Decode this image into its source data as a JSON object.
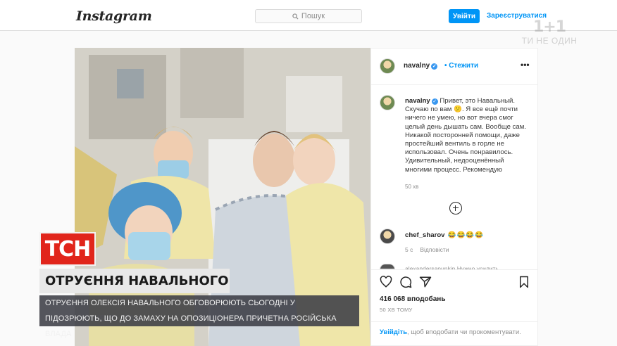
{
  "topbar": {
    "logo_text": "Instagram",
    "search_placeholder": "Пошук",
    "login_label": "Увійти",
    "signup_label": "Зареєструватися"
  },
  "channel": {
    "logo_mark": "1+1",
    "slogan": "ТИ НЕ ОДИН"
  },
  "post": {
    "username": "navalny",
    "follow_label": "Стежити",
    "more_label": "•••",
    "caption": "Привет, это Навальный. Скучаю по вам 😕. Я все ещё почти ничего не умею, но вот вчера смог целый день дышать сам. Вообще сам. Никакой посторонней помощи, даже простейший вентиль в горле не использовал. Очень понравилось. Удивительный, недооценённый многими процесс. Рекомендую",
    "caption_time": "50 хв",
    "comment": {
      "username": "chef_sharov",
      "text": "😂😂😂😂",
      "time": "5 с",
      "reply_label": "Відповісти",
      "next_username_cut": "alexandersapunkin Нужно усилить"
    },
    "likes": "416 068 вподобань",
    "posted_ago": "50 ХВ ТОМУ",
    "login_prompt_link": "Увійдіть",
    "login_prompt_text": ", щоб вподобати чи прокоментувати."
  },
  "tsn": {
    "logo": "ТСН",
    "headline": "ОТРУЄННЯ НАВАЛЬНОГО",
    "subline_1": "ОТРУЄННЯ ОЛЕКСІЯ НАВАЛЬНОГО ОБГОВОРЮЮТЬ СЬОГОДНІ У ЄВРОПАРЛАМЕНТІ - ТАМ",
    "subline_2": "ПІДОЗРЮЮТЬ, ЩО ДО ЗАМАХУ НА ОПОЗИЦІОНЕРА ПРИЧЕТНА РОСІЙСЬКА ВЛАДА"
  },
  "colors": {
    "instagram_blue": "#0095f6",
    "tsn_red": "#e1251b",
    "subline_bg": "#3c3e46"
  }
}
